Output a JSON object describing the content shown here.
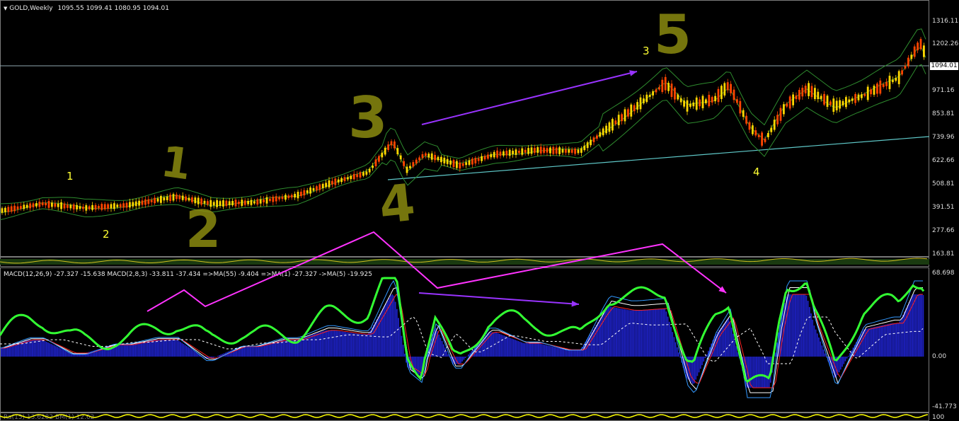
{
  "window": {
    "symbol_label": "GOLD,Weekly",
    "ohlc": "1095.55 1099.41 1080.95 1094.01"
  },
  "price_axis": {
    "ticks": [
      "1316.11",
      "1202.26",
      "971.16",
      "853.81",
      "739.96",
      "622.66",
      "508.81",
      "391.51",
      "277.66",
      "163.81"
    ],
    "current": "1094.01"
  },
  "annotations": {
    "wave_labels": [
      "1",
      "2",
      "3",
      "4"
    ],
    "hand_labels": [
      "1",
      "2",
      "3",
      "4",
      "5"
    ]
  },
  "macd": {
    "header": "MACD(12,26,9) -27.327 -15.638  MACD(2,8,3) -33.811 -37.434  =>MA(55) -9.404  =>MA(1) -27.327  ->MA(5) -19.925",
    "ticks": [
      "68.698",
      "0.00",
      "-41.773"
    ]
  },
  "bottom_pane": {
    "header": "Ra(15) 13.6282   BM(1) 12.62",
    "tick": "100"
  },
  "colors": {
    "candle_up": "#ffd700",
    "candle_down": "#ff4500",
    "band": "#2e8b2e",
    "trendline": "#5fc9c9",
    "arrow_magenta": "#ff33ff",
    "arrow_violet": "#9933ff",
    "macd_hist": "#1e22c8",
    "macd_signal_green": "#33ff33",
    "hand_label": "#8a8a10",
    "wave_label": "#ffff33"
  },
  "icons": [
    "dropdown-triangle-icon"
  ]
}
